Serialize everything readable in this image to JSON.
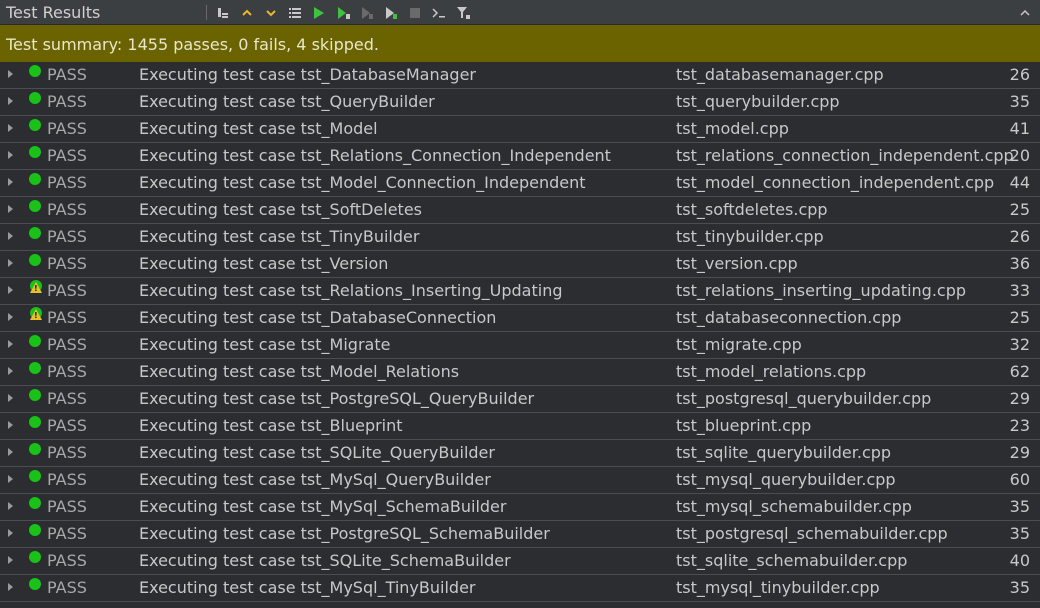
{
  "panel": {
    "title": "Test Results"
  },
  "summary": {
    "text": "Test summary:   1455 passes, 0 fails, 4 skipped."
  },
  "toolbar": {
    "icons": [
      "sort-icon",
      "previous-arrow-icon",
      "next-arrow-icon",
      "list-icon",
      "run-icon",
      "run-selected-icon",
      "debug-icon",
      "run-file-icon",
      "stop-icon",
      "terminal-icon",
      "filter-icon"
    ],
    "collapse_icon": "collapse-chevron-icon"
  },
  "colors": {
    "summary_bg": "#6b6200",
    "pass_green": "#19c119",
    "warn_yellow": "#e8c12a"
  },
  "rows": [
    {
      "icon": "pass",
      "status": "PASS",
      "desc": "Executing test case tst_DatabaseManager",
      "file": "tst_databasemanager.cpp",
      "line": "26"
    },
    {
      "icon": "pass",
      "status": "PASS",
      "desc": "Executing test case tst_QueryBuilder",
      "file": "tst_querybuilder.cpp",
      "line": "35"
    },
    {
      "icon": "pass",
      "status": "PASS",
      "desc": "Executing test case tst_Model",
      "file": "tst_model.cpp",
      "line": "41"
    },
    {
      "icon": "pass",
      "status": "PASS",
      "desc": "Executing test case tst_Relations_Connection_Independent",
      "file": "tst_relations_connection_independent.cpp",
      "line": "20"
    },
    {
      "icon": "pass",
      "status": "PASS",
      "desc": "Executing test case tst_Model_Connection_Independent",
      "file": "tst_model_connection_independent.cpp",
      "line": "44"
    },
    {
      "icon": "pass",
      "status": "PASS",
      "desc": "Executing test case tst_SoftDeletes",
      "file": "tst_softdeletes.cpp",
      "line": "25"
    },
    {
      "icon": "pass",
      "status": "PASS",
      "desc": "Executing test case tst_TinyBuilder",
      "file": "tst_tinybuilder.cpp",
      "line": "26"
    },
    {
      "icon": "pass",
      "status": "PASS",
      "desc": "Executing test case tst_Version",
      "file": "tst_version.cpp",
      "line": "36"
    },
    {
      "icon": "warn",
      "status": "PASS",
      "desc": "Executing test case tst_Relations_Inserting_Updating",
      "file": "tst_relations_inserting_updating.cpp",
      "line": "33"
    },
    {
      "icon": "warn",
      "status": "PASS",
      "desc": "Executing test case tst_DatabaseConnection",
      "file": "tst_databaseconnection.cpp",
      "line": "25"
    },
    {
      "icon": "pass",
      "status": "PASS",
      "desc": "Executing test case tst_Migrate",
      "file": "tst_migrate.cpp",
      "line": "32"
    },
    {
      "icon": "pass",
      "status": "PASS",
      "desc": "Executing test case tst_Model_Relations",
      "file": "tst_model_relations.cpp",
      "line": "62"
    },
    {
      "icon": "pass",
      "status": "PASS",
      "desc": "Executing test case tst_PostgreSQL_QueryBuilder",
      "file": "tst_postgresql_querybuilder.cpp",
      "line": "29"
    },
    {
      "icon": "pass",
      "status": "PASS",
      "desc": "Executing test case tst_Blueprint",
      "file": "tst_blueprint.cpp",
      "line": "23"
    },
    {
      "icon": "pass",
      "status": "PASS",
      "desc": "Executing test case tst_SQLite_QueryBuilder",
      "file": "tst_sqlite_querybuilder.cpp",
      "line": "29"
    },
    {
      "icon": "pass",
      "status": "PASS",
      "desc": "Executing test case tst_MySql_QueryBuilder",
      "file": "tst_mysql_querybuilder.cpp",
      "line": "60"
    },
    {
      "icon": "pass",
      "status": "PASS",
      "desc": "Executing test case tst_MySql_SchemaBuilder",
      "file": "tst_mysql_schemabuilder.cpp",
      "line": "35"
    },
    {
      "icon": "pass",
      "status": "PASS",
      "desc": "Executing test case tst_PostgreSQL_SchemaBuilder",
      "file": "tst_postgresql_schemabuilder.cpp",
      "line": "35"
    },
    {
      "icon": "pass",
      "status": "PASS",
      "desc": "Executing test case tst_SQLite_SchemaBuilder",
      "file": "tst_sqlite_schemabuilder.cpp",
      "line": "40"
    },
    {
      "icon": "pass",
      "status": "PASS",
      "desc": "Executing test case tst_MySql_TinyBuilder",
      "file": "tst_mysql_tinybuilder.cpp",
      "line": "35"
    }
  ]
}
